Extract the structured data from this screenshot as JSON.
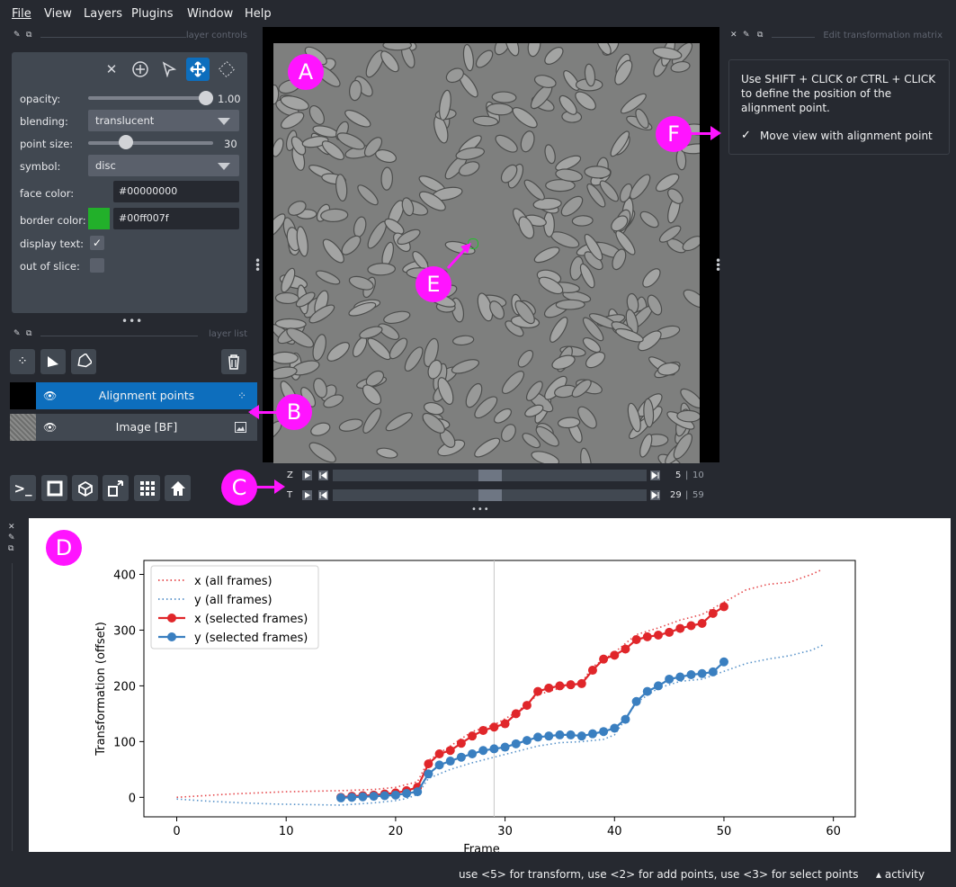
{
  "menu": [
    "File",
    "View",
    "Layers",
    "Plugins",
    "Window",
    "Help"
  ],
  "layer_controls": {
    "title": "layer controls",
    "opacity_label": "opacity:",
    "opacity_value": "1.00",
    "opacity_level": 1.0,
    "blending_label": "blending:",
    "blending_value": "translucent",
    "point_size_label": "point size:",
    "point_size_value": "30",
    "point_size_level": 0.3,
    "symbol_label": "symbol:",
    "symbol_value": "disc",
    "face_color_label": "face color:",
    "face_color_value": "#00000000",
    "border_color_label": "border color:",
    "border_color_value": "#00ff007f",
    "border_swatch": "#22b02a",
    "display_text_label": "display text:",
    "display_text_checked": true,
    "out_of_slice_label": "out of slice:",
    "out_of_slice_checked": false
  },
  "layer_list": {
    "title": "layer list",
    "layers": [
      {
        "name": "Alignment points",
        "selected": true,
        "icon": "points-icon"
      },
      {
        "name": "Image [BF]",
        "selected": false,
        "icon": "image-icon"
      }
    ]
  },
  "dims": [
    {
      "label": "Z",
      "current": "5",
      "max": "10",
      "fraction": 0.5
    },
    {
      "label": "T",
      "current": "29",
      "max": "59",
      "fraction": 0.5
    }
  ],
  "transform_panel": {
    "title": "Edit transformation matrix",
    "instructions": "Use SHIFT + CLICK or CTRL + CLICK to define the position of the alignment point.",
    "checkbox_label": "Move view with alignment point",
    "checkbox_checked": true
  },
  "markers": [
    "A",
    "B",
    "C",
    "D",
    "E",
    "F"
  ],
  "colors": {
    "accent": "#0d6ebd",
    "marker": "#ff14ff",
    "x_series": "#e0262a",
    "y_series": "#3a7fc0"
  },
  "status": {
    "message": "use <5> for transform, use <2> for add points, use <3> for select points",
    "activity": "activity"
  },
  "chart_data": {
    "type": "line",
    "xlabel": "Frame",
    "ylabel": "Transformation (offset)",
    "xlim": [
      -3,
      62
    ],
    "ylim": [
      -35,
      425
    ],
    "xticks": [
      0,
      10,
      20,
      30,
      40,
      50,
      60
    ],
    "yticks": [
      0,
      100,
      200,
      300,
      400
    ],
    "vline_x": 29,
    "legend_position": "upper left",
    "series": [
      {
        "name": "x (all frames)",
        "style": "dotted",
        "color": "#e0262a",
        "x": [
          0,
          5,
          10,
          15,
          18,
          20,
          22,
          23,
          25,
          27,
          29,
          31,
          33,
          35,
          37,
          38,
          40,
          42,
          44,
          46,
          48,
          50,
          52,
          54,
          56,
          58,
          59
        ],
        "y": [
          0,
          6,
          10,
          12,
          14,
          18,
          28,
          66,
          92,
          118,
          130,
          152,
          184,
          196,
          206,
          234,
          260,
          292,
          304,
          318,
          328,
          350,
          372,
          382,
          386,
          400,
          409
        ]
      },
      {
        "name": "y (all frames)",
        "style": "dotted",
        "color": "#3a7fc0",
        "x": [
          0,
          3,
          6,
          9,
          12,
          15,
          18,
          20,
          21,
          22,
          23,
          25,
          27,
          29,
          31,
          33,
          35,
          37,
          39,
          40,
          41,
          42,
          44,
          46,
          48,
          50,
          52,
          54,
          56,
          58,
          59
        ],
        "y": [
          -3,
          -7,
          -10,
          -12,
          -13,
          -14,
          -10,
          -6,
          -2,
          5,
          34,
          50,
          62,
          72,
          82,
          92,
          98,
          100,
          104,
          112,
          140,
          170,
          196,
          208,
          212,
          226,
          240,
          248,
          254,
          264,
          273
        ]
      },
      {
        "name": "x (selected frames)",
        "style": "solid-dots",
        "color": "#e0262a",
        "x": [
          15,
          16,
          17,
          18,
          19,
          20,
          21,
          22,
          23,
          24,
          25,
          26,
          27,
          28,
          29,
          30,
          31,
          32,
          33,
          34,
          35,
          36,
          37,
          38,
          39,
          40,
          41,
          42,
          43,
          44,
          45,
          46,
          47,
          48,
          49,
          50
        ],
        "y": [
          0,
          2,
          3,
          4,
          6,
          8,
          12,
          18,
          60,
          78,
          84,
          97,
          110,
          120,
          126,
          132,
          150,
          165,
          190,
          196,
          200,
          202,
          204,
          228,
          248,
          255,
          266,
          283,
          288,
          291,
          296,
          303,
          308,
          312,
          330,
          342
        ]
      },
      {
        "name": "y (selected frames)",
        "style": "solid-dots",
        "color": "#3a7fc0",
        "x": [
          15,
          16,
          17,
          18,
          19,
          20,
          21,
          22,
          23,
          24,
          25,
          26,
          27,
          28,
          29,
          30,
          31,
          32,
          33,
          34,
          35,
          36,
          37,
          38,
          39,
          40,
          41,
          42,
          43,
          44,
          45,
          46,
          47,
          48,
          49,
          50
        ],
        "y": [
          -1,
          0,
          1,
          2,
          3,
          4,
          7,
          10,
          42,
          58,
          65,
          72,
          78,
          84,
          87,
          90,
          96,
          102,
          108,
          110,
          112,
          112,
          110,
          114,
          118,
          124,
          140,
          172,
          190,
          200,
          212,
          216,
          220,
          222,
          225,
          243
        ]
      }
    ]
  }
}
